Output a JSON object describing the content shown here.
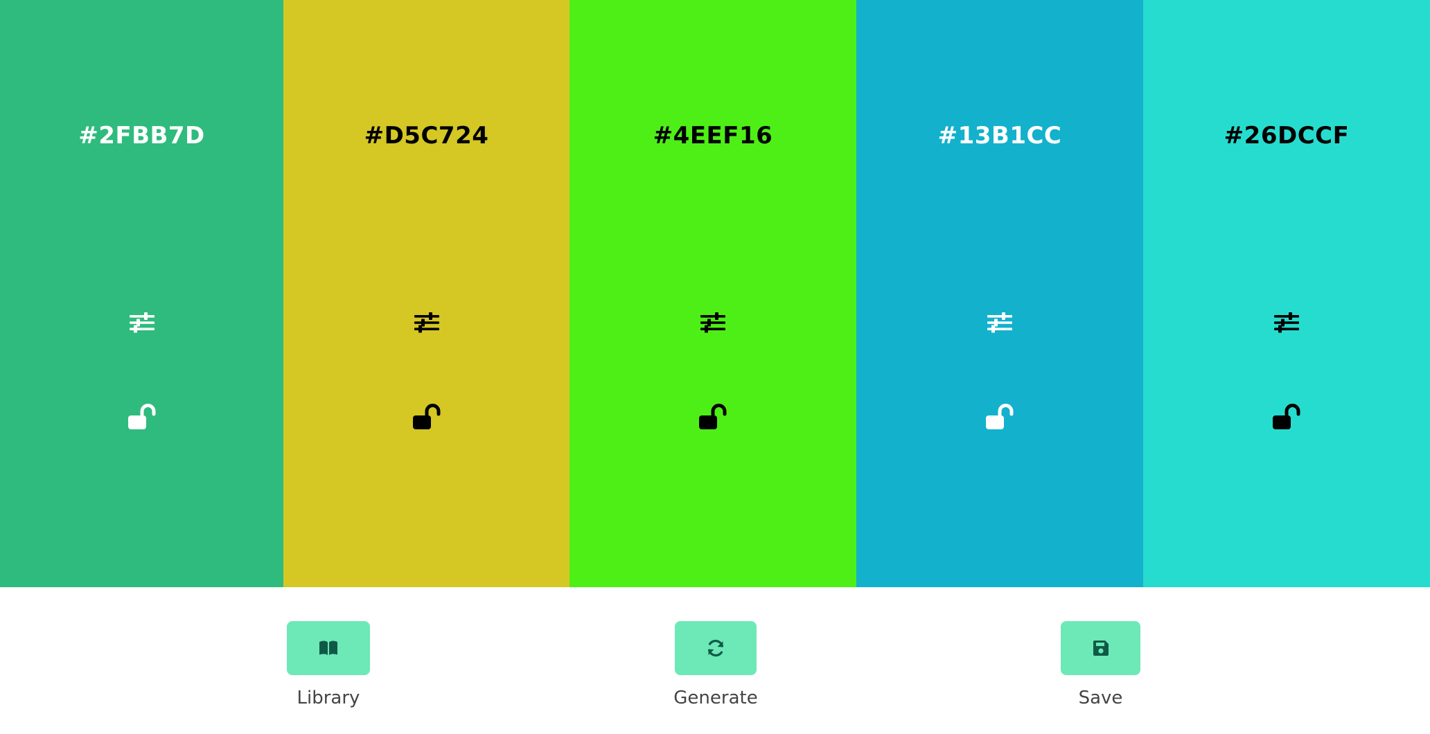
{
  "palette": {
    "colors": [
      {
        "hex": "#2FBB7D",
        "bg": "#2FBB7D",
        "fg": "#ffffff"
      },
      {
        "hex": "#D5C724",
        "bg": "#D5C724",
        "fg": "#000000"
      },
      {
        "hex": "#4EEF16",
        "bg": "#4EEF16",
        "fg": "#000000"
      },
      {
        "hex": "#13B1CC",
        "bg": "#13B1CC",
        "fg": "#ffffff"
      },
      {
        "hex": "#26DCCF",
        "bg": "#26DCCF",
        "fg": "#000000"
      }
    ],
    "adjust_icon": "sliders-icon",
    "lock_icon": "unlock-icon"
  },
  "toolbar": {
    "accent": "#6DE8B7",
    "icon_color": "#0F5A47",
    "library": {
      "label": "Library",
      "icon": "book-open-icon"
    },
    "generate": {
      "label": "Generate",
      "icon": "refresh-icon"
    },
    "save": {
      "label": "Save",
      "icon": "floppy-disk-icon"
    }
  }
}
